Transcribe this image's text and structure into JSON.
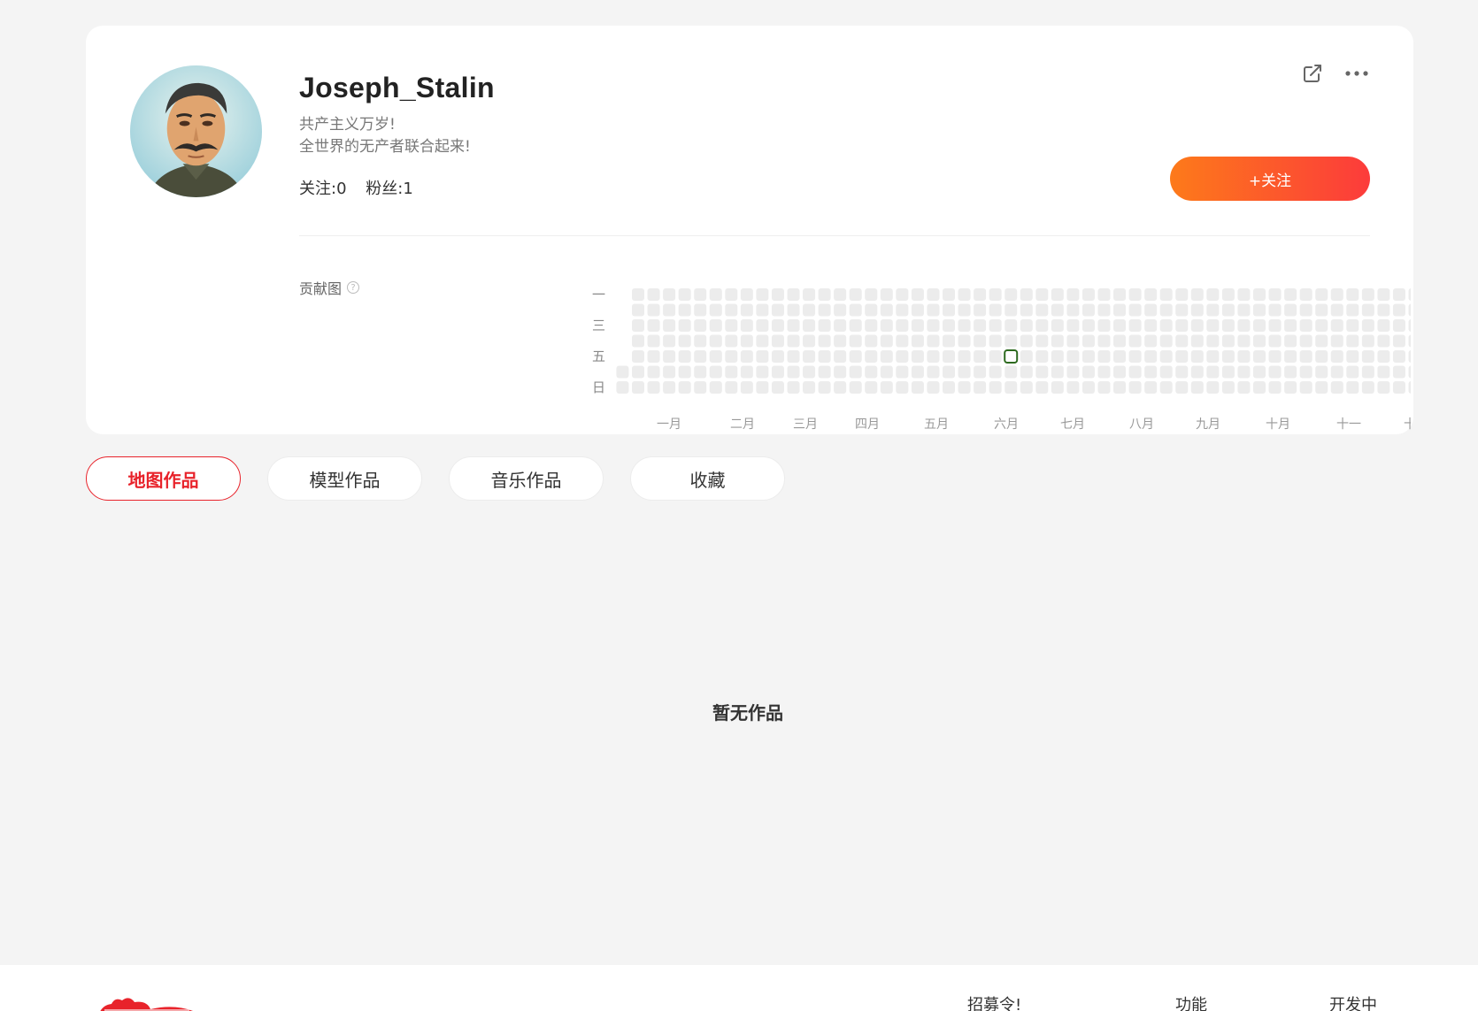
{
  "profile": {
    "username": "Joseph_Stalin",
    "bio_line1": "共产主义万岁!",
    "bio_line2": "全世界的无产者联合起来!",
    "following": "关注:0",
    "followers": "粉丝:1",
    "follow_button": "+关注"
  },
  "icons": {
    "share": "share-icon",
    "more": "more-icon",
    "help": "help-icon"
  },
  "contributions": {
    "label": "贡献图",
    "help_symbol": "?",
    "day_labels": [
      "一",
      "三",
      "五",
      "日"
    ],
    "month_labels": [
      "一月",
      "二月",
      "三月",
      "四月",
      "五月",
      "六月",
      "七月",
      "八月",
      "九月",
      "十月",
      "十一",
      "十二"
    ],
    "weeks": 53,
    "active_cells": [
      {
        "week": 25,
        "day": 4
      }
    ]
  },
  "tabs": [
    {
      "label": "地图作品",
      "active": true
    },
    {
      "label": "模型作品",
      "active": false
    },
    {
      "label": "音乐作品",
      "active": false
    },
    {
      "label": "收藏",
      "active": false
    }
  ],
  "empty_message": "暂无作品",
  "footer": {
    "links": [
      "招募令!",
      "功能",
      "开发中"
    ]
  },
  "colors": {
    "accent": "#e8232b",
    "follow_gradient_start": "#fd7a1a",
    "follow_gradient_end": "#fc3b3b",
    "cell_empty": "#ececec",
    "cell_active_border": "#2d6a1f"
  }
}
